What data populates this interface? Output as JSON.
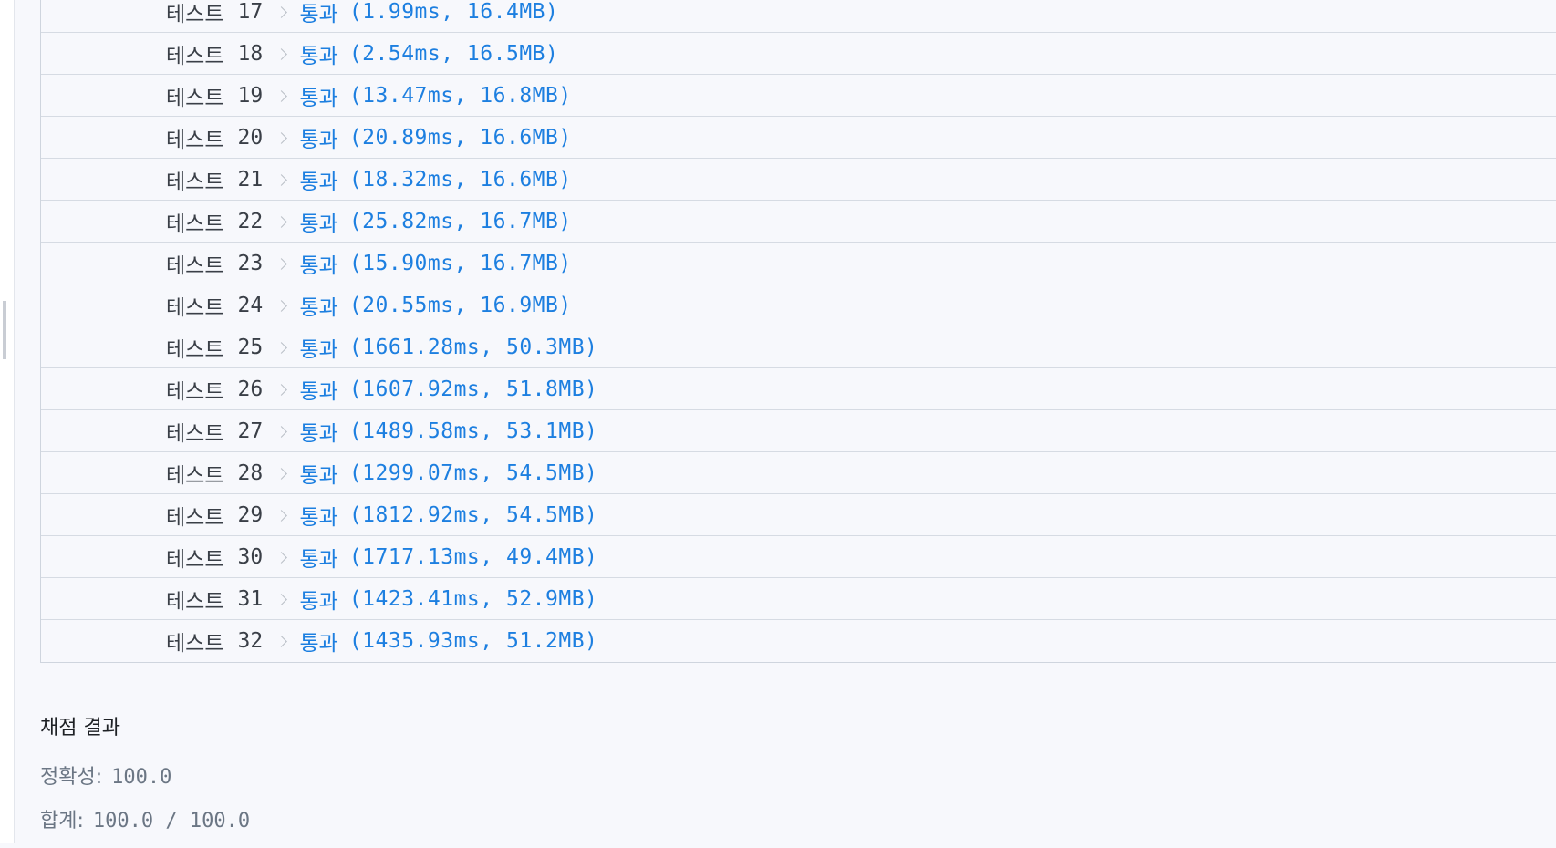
{
  "tests": [
    {
      "label": "테스트",
      "num": "17",
      "result": "통과",
      "detail": "(1.99ms, 16.4MB)"
    },
    {
      "label": "테스트",
      "num": "18",
      "result": "통과",
      "detail": "(2.54ms, 16.5MB)"
    },
    {
      "label": "테스트",
      "num": "19",
      "result": "통과",
      "detail": "(13.47ms, 16.8MB)"
    },
    {
      "label": "테스트",
      "num": "20",
      "result": "통과",
      "detail": "(20.89ms, 16.6MB)"
    },
    {
      "label": "테스트",
      "num": "21",
      "result": "통과",
      "detail": "(18.32ms, 16.6MB)"
    },
    {
      "label": "테스트",
      "num": "22",
      "result": "통과",
      "detail": "(25.82ms, 16.7MB)"
    },
    {
      "label": "테스트",
      "num": "23",
      "result": "통과",
      "detail": "(15.90ms, 16.7MB)"
    },
    {
      "label": "테스트",
      "num": "24",
      "result": "통과",
      "detail": "(20.55ms, 16.9MB)"
    },
    {
      "label": "테스트",
      "num": "25",
      "result": "통과",
      "detail": "(1661.28ms, 50.3MB)"
    },
    {
      "label": "테스트",
      "num": "26",
      "result": "통과",
      "detail": "(1607.92ms, 51.8MB)"
    },
    {
      "label": "테스트",
      "num": "27",
      "result": "통과",
      "detail": "(1489.58ms, 53.1MB)"
    },
    {
      "label": "테스트",
      "num": "28",
      "result": "통과",
      "detail": "(1299.07ms, 54.5MB)"
    },
    {
      "label": "테스트",
      "num": "29",
      "result": "통과",
      "detail": "(1812.92ms, 54.5MB)"
    },
    {
      "label": "테스트",
      "num": "30",
      "result": "통과",
      "detail": "(1717.13ms, 49.4MB)"
    },
    {
      "label": "테스트",
      "num": "31",
      "result": "통과",
      "detail": "(1423.41ms, 52.9MB)"
    },
    {
      "label": "테스트",
      "num": "32",
      "result": "통과",
      "detail": "(1435.93ms, 51.2MB)"
    }
  ],
  "grading": {
    "title": "채점 결과",
    "accuracy_label": "정확성:",
    "accuracy_value": "100.0",
    "total_label": "합계:",
    "total_value": "100.0 / 100.0"
  },
  "colors": {
    "pass": "#1d7fe0",
    "text": "#3a3f47",
    "muted": "#6b7684",
    "background": "#f7f8fc"
  },
  "icons": {
    "row_separator": "chevron-right-icon",
    "panel_handle": "resize-handle-icon"
  }
}
